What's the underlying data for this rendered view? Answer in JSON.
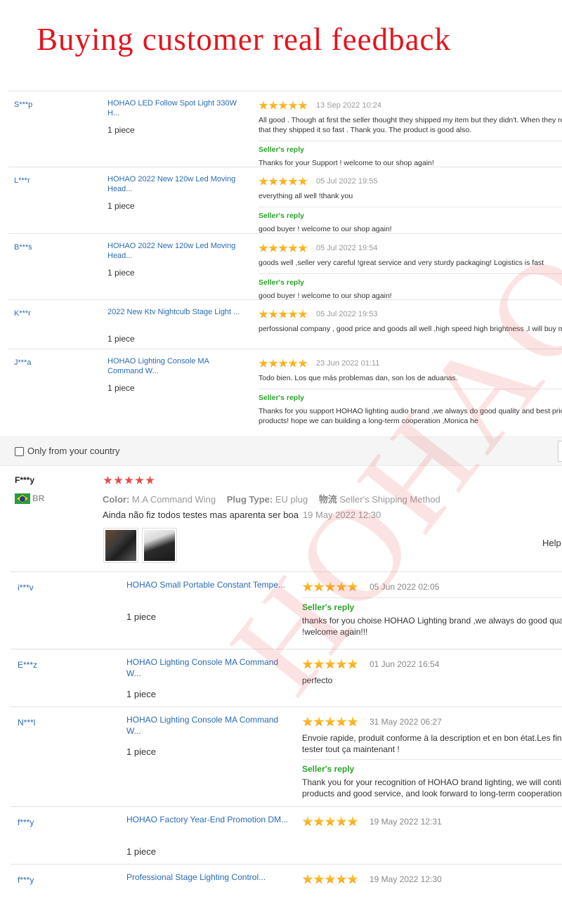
{
  "banner": {
    "title": "Buying customer real feedback",
    "watermark": "HOHAO"
  },
  "reviews_top": [
    {
      "user": "S***p",
      "product": "HOHAO LED Follow Spot Light 330W H...",
      "qty": "1 piece",
      "date": "13 Sep 2022 10:24",
      "text": [
        "All good . Though at first the seller thought they shipped my item but they didn't. When they rea",
        "that they shipped it so fast . Thank you. The product is good also."
      ],
      "reply_label": "Seller's reply",
      "reply": [
        "Thanks for your Support ! welcome to our shop again!"
      ]
    },
    {
      "user": "L***r",
      "product": "HOHAO 2022 New 120w Led Moving Head...",
      "qty": "1 piece",
      "date": "05 Jul 2022 19:55",
      "text": [
        "everything all well !thank you"
      ],
      "reply_label": "Seller's reply",
      "reply": [
        "good buyer ! welcome to our shop again!"
      ]
    },
    {
      "user": "B***s",
      "product": "HOHAO 2022 New 120w Led Moving Head...",
      "qty": "1 piece",
      "date": "05 Jul 2022 19:54",
      "text": [
        "goods well ,seller very careful !great service and very sturdy packaging! Logistics is fast"
      ],
      "reply_label": "Seller's reply",
      "reply": [
        "good buyer ! welcome to our shop again!"
      ]
    },
    {
      "user": "K***r",
      "product": "2022 New Ktv Nightculb Stage Light ...",
      "qty": "1 piece",
      "date": "05 Jul 2022 19:53",
      "text": [
        "perfossional company , good price and goods all well ,high speed high brightness ,I will buy mo"
      ]
    },
    {
      "user": "J***a",
      "product": "HOHAO Lighting Console MA Command W...",
      "qty": "1 piece",
      "date": "23 Jun 2022 01:11",
      "text": [
        "Todo bien. Los que más problemas dan, son los de aduanas."
      ],
      "reply_label": "Seller's reply",
      "reply": [
        "Thanks for you support HOHAO lighting audio brand ,we always do good quality and best price",
        "products! hope we can building a long-term cooperation ,Monica he"
      ]
    }
  ],
  "filter": {
    "label": "Only from your country",
    "checked": false
  },
  "featured": {
    "user": "F***y",
    "country": "BR",
    "stars": 5,
    "color_label": "Color:",
    "color_value": "M.A Command Wing",
    "plug_label": "Plug Type:",
    "plug_value": "EU plug",
    "ship_label": "物流",
    "ship_value": "Seller's Shipping Method",
    "text": "Ainda não fiz todos testes mas aparenta ser boa",
    "date": "19 May 2022 12:30",
    "helpful": "Help"
  },
  "reviews_bottom": [
    {
      "user": "i***v",
      "product": "HOHAO Small Portable Constant Tempe...",
      "qty": "1 piece",
      "date": "05 Jun 2022 02:05",
      "text": [],
      "reply_label": "Seller's reply",
      "reply": [
        "thanks for you choise HOHAO Lighting brand ,we always do good qua",
        "!welcome again!!!"
      ]
    },
    {
      "user": "E***z",
      "product": "HOHAO Lighting Console MA Command W...",
      "qty": "1 piece",
      "date": "01 Jun 2022 16:54",
      "text": [
        "perfecto"
      ]
    },
    {
      "user": "N***l",
      "product": "HOHAO Lighting Console MA Command W...",
      "qty": "1 piece",
      "date": "31 May 2022 06:27",
      "text": [
        "Envoie rapide, produit conforme à la description et en bon état.Les fin",
        "tester tout ça maintenant !"
      ],
      "reply_label": "Seller's reply",
      "reply": [
        "Thank you for your recognition of HOHAO brand lighting, we will conti",
        "products and good service, and look forward to long-term cooperation"
      ]
    },
    {
      "user": "f***y",
      "product": "HOHAO Factory Year-End Promotion DM...",
      "qty": "1 piece",
      "date": "19 May 2022 12:31",
      "text": []
    },
    {
      "user": "f***y",
      "product": "Professional Stage Lighting Control...",
      "qty": "",
      "date": "19 May 2022 12:30",
      "text": []
    }
  ]
}
